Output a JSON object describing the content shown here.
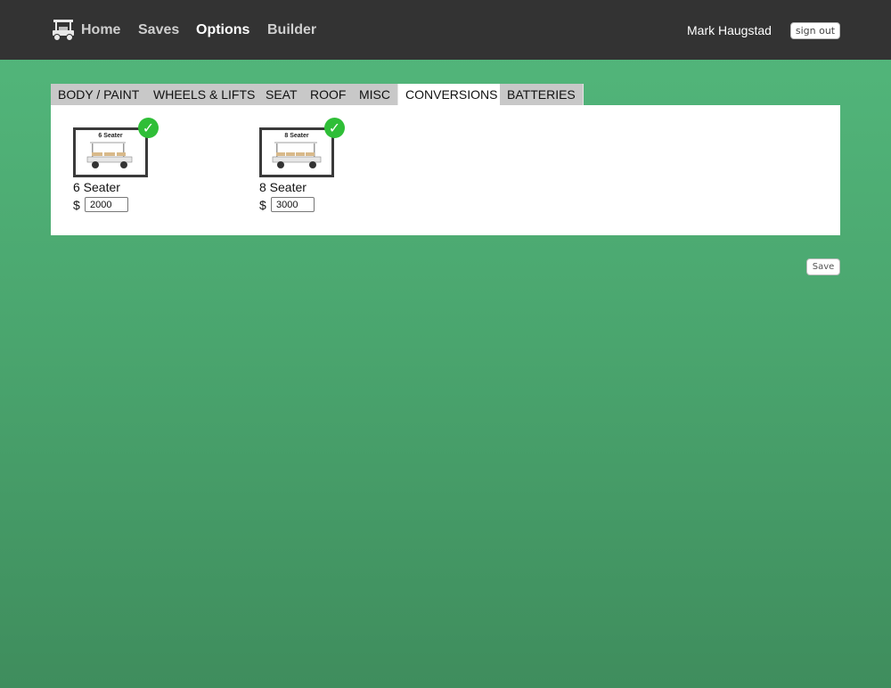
{
  "nav": {
    "logo_icon": "golf-cart-icon",
    "links": [
      {
        "label": "Home",
        "active": false
      },
      {
        "label": "Saves",
        "active": false
      },
      {
        "label": "Options",
        "active": true
      },
      {
        "label": "Builder",
        "active": false
      }
    ],
    "user_name": "Mark Haugstad",
    "signout_label": "sign out"
  },
  "tabs": [
    {
      "label": "BODY / PAINT",
      "active": false
    },
    {
      "label": "WHEELS & LIFTS",
      "active": false
    },
    {
      "label": "SEAT",
      "active": false
    },
    {
      "label": "ROOF",
      "active": false
    },
    {
      "label": "MISC",
      "active": false
    },
    {
      "label": "CONVERSIONS",
      "active": true
    },
    {
      "label": "BATTERIES",
      "active": false
    }
  ],
  "options": [
    {
      "thumb_label": "6 Seater",
      "name": "6 Seater",
      "currency": "$",
      "price": "2000",
      "selected": true
    },
    {
      "thumb_label": "8 Seater",
      "name": "8 Seater",
      "currency": "$",
      "price": "3000",
      "selected": true
    }
  ],
  "check_glyph": "✓",
  "save_label": "Save",
  "colors": {
    "topbar": "#333333",
    "accent_green": "#2fbe37",
    "background_green": "#4aa56e"
  }
}
